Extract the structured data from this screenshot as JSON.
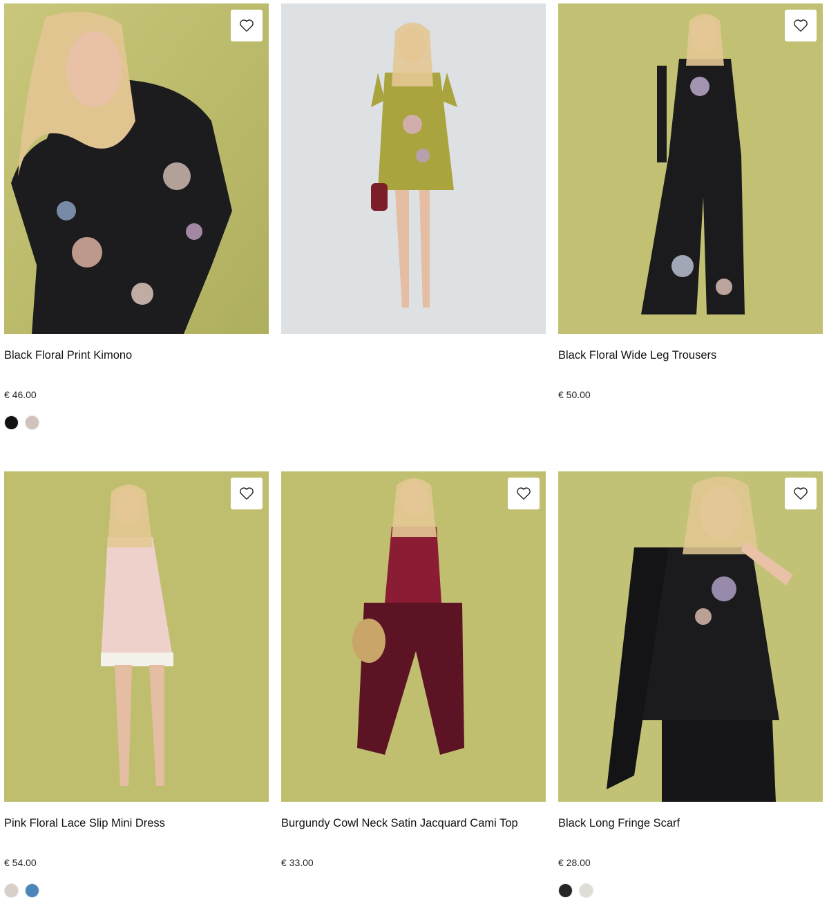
{
  "products": [
    {
      "name": "Black Floral Print Kimono",
      "price": "€ 46.00",
      "image": "model-black-floral-kimono",
      "swatches": [
        "#111111",
        "#cfc3bb"
      ],
      "wishlist_icon": "heart-icon"
    },
    {
      "name": "",
      "price": "",
      "image": "model-green-satin-mini-dress",
      "swatches": [],
      "wishlist_icon": ""
    },
    {
      "name": "Black Floral Wide Leg Trousers",
      "price": "€ 50.00",
      "image": "model-black-floral-trousers",
      "swatches": [],
      "wishlist_icon": "heart-icon"
    },
    {
      "name": "Pink Floral Lace Slip Mini Dress",
      "price": "€ 54.00",
      "image": "model-pink-slip-dress",
      "swatches": [
        "#d8cfc8",
        "#4a86bb"
      ],
      "wishlist_icon": "heart-icon"
    },
    {
      "name": "Burgundy Cowl Neck Satin Jacquard Cami Top",
      "price": "€ 33.00",
      "image": "model-burgundy-cami-top",
      "swatches": [],
      "wishlist_icon": "heart-icon"
    },
    {
      "name": "Black Long Fringe Scarf",
      "price": "€ 28.00",
      "image": "model-black-fringe-scarf",
      "swatches": [
        "#262626",
        "#deddd6"
      ],
      "wishlist_icon": "heart-icon"
    }
  ],
  "colors": {
    "backdrop_olive": "#bcbd6a",
    "backdrop_grey": "#dde1e4",
    "text": "#111111"
  }
}
